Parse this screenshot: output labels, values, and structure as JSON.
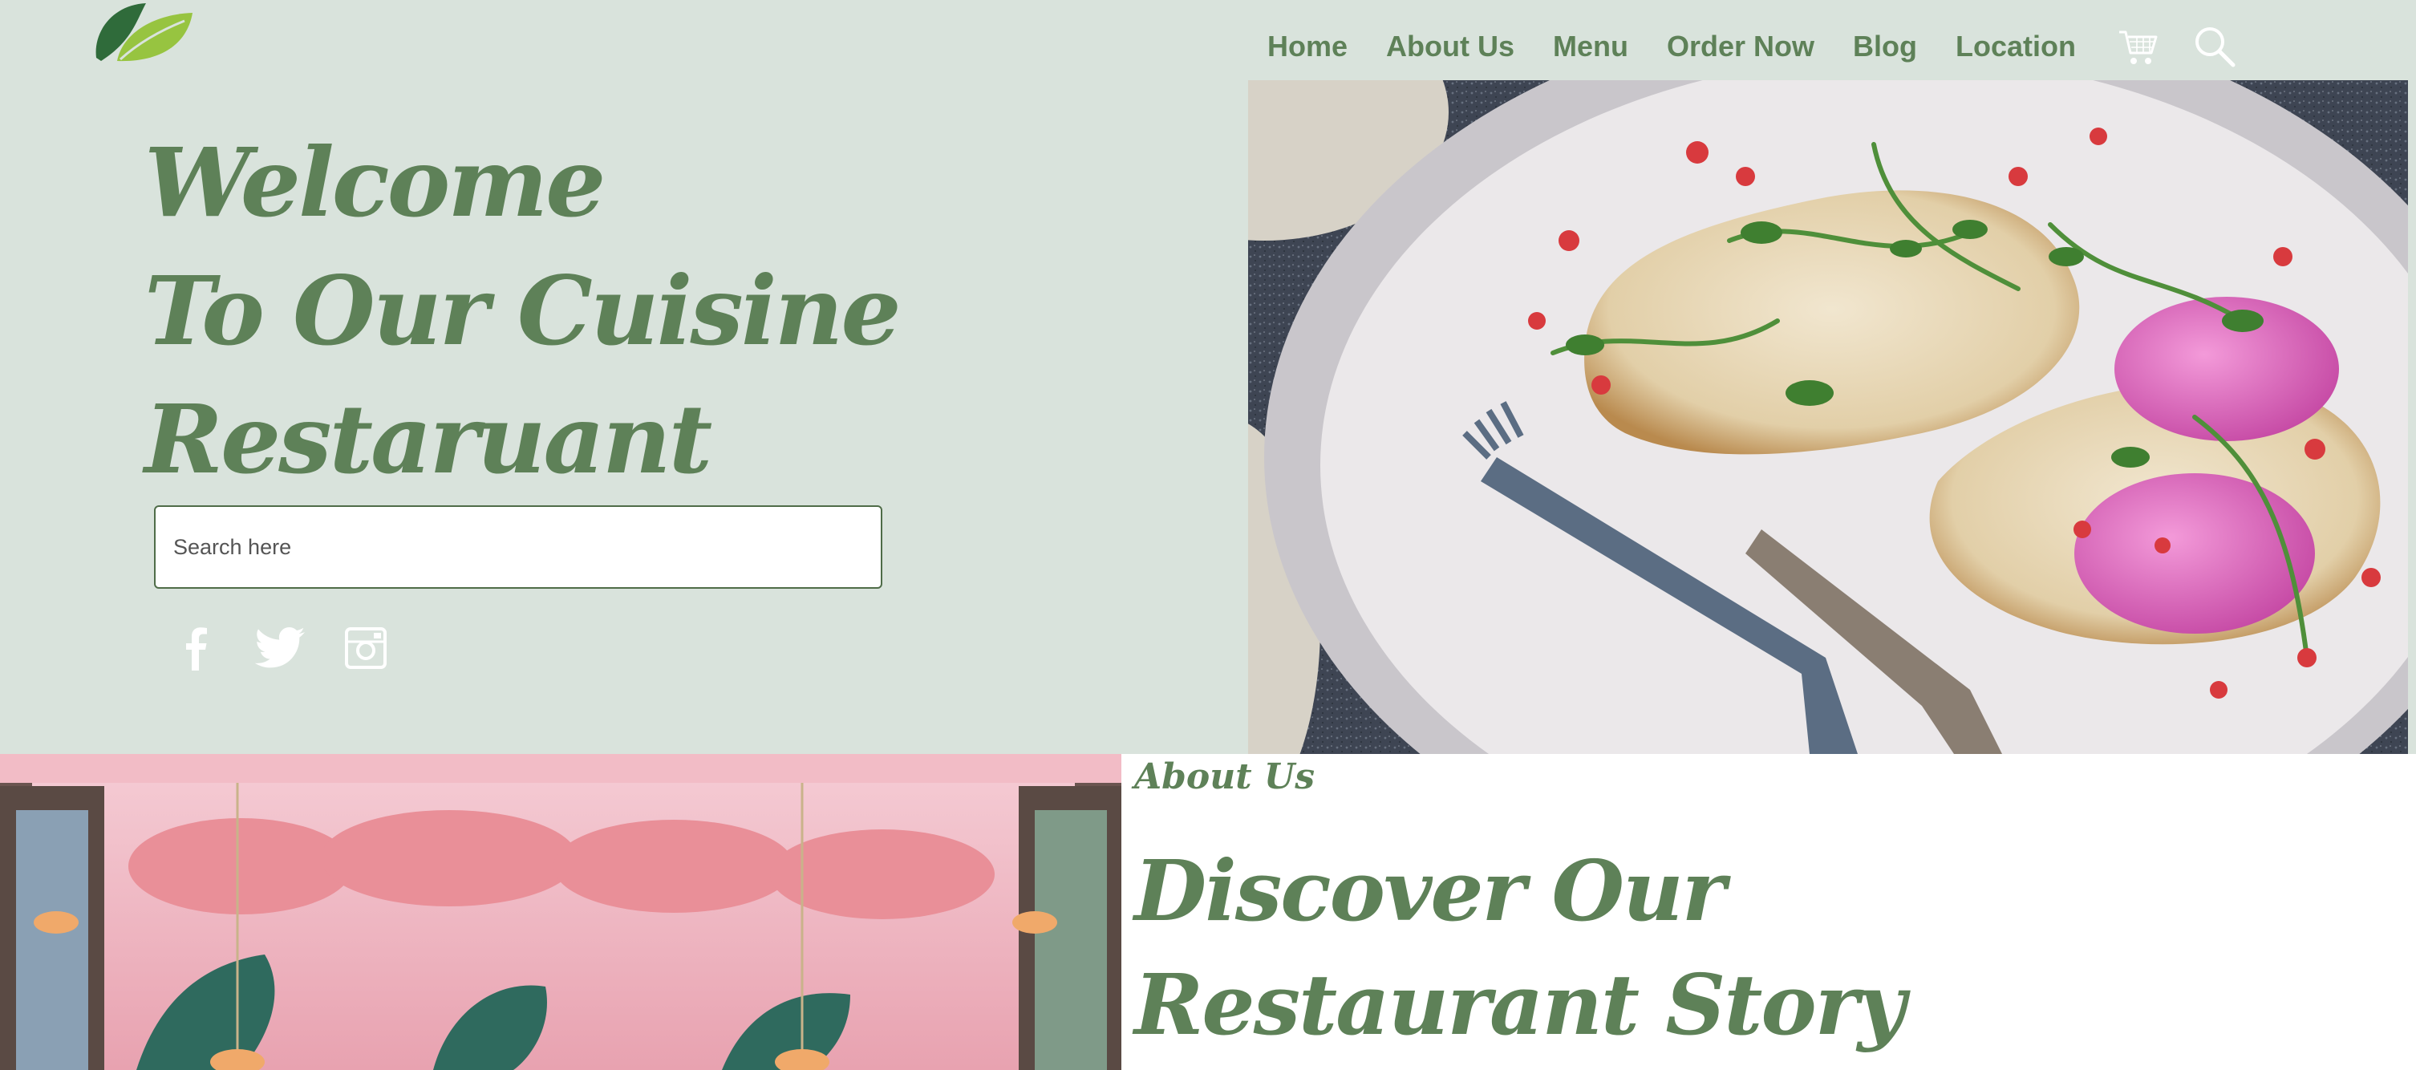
{
  "brand": {
    "logo": "leaf-logo",
    "primary_color": "#5e8158",
    "hero_bg": "#d9e3dc"
  },
  "nav": {
    "items": [
      {
        "label": "Home"
      },
      {
        "label": "About Us"
      },
      {
        "label": "Menu"
      },
      {
        "label": "Order Now"
      },
      {
        "label": "Blog"
      },
      {
        "label": "Location"
      }
    ],
    "icons": [
      "cart-icon",
      "search-icon"
    ]
  },
  "hero": {
    "title_lines": [
      "Welcome",
      "To Our Cuisine",
      "Restaruant"
    ],
    "search_placeholder": "Search here",
    "social_icons": [
      "facebook-icon",
      "twitter-icon",
      "instagram-icon"
    ],
    "image": "plate-of-toast-with-pink-eggs-photo"
  },
  "about": {
    "label": "About Us",
    "heading_lines": [
      "Discover Our",
      "Restaurant Story"
    ],
    "image": "pink-mural-dining-room-photo"
  }
}
